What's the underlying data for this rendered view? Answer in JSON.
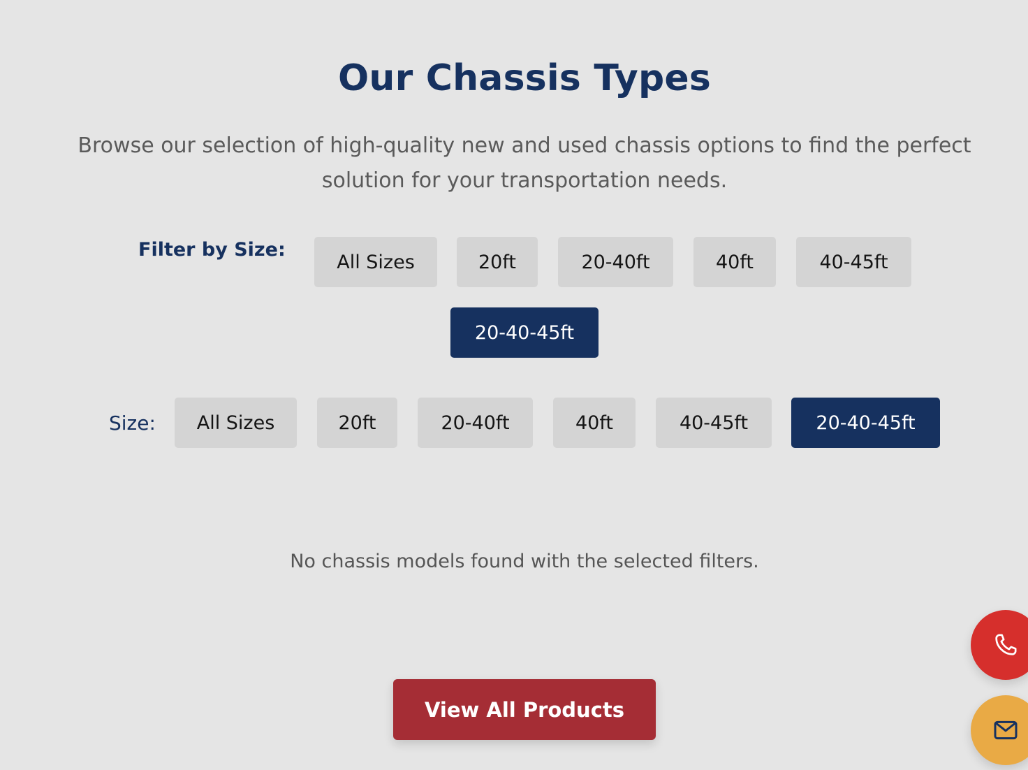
{
  "section": {
    "title": "Our Chassis Types",
    "subtitle": "Browse our selection of high-quality new and used chassis options to find the perfect solution for your transportation needs."
  },
  "filter_by_size": {
    "label": "Filter by Size:",
    "options": [
      "All Sizes",
      "20ft",
      "20-40ft",
      "40ft",
      "40-45ft",
      "20-40-45ft"
    ],
    "selected": "20-40-45ft"
  },
  "size_filter": {
    "label": "Size:",
    "options": [
      "All Sizes",
      "20ft",
      "20-40ft",
      "40ft",
      "40-45ft",
      "20-40-45ft"
    ],
    "selected": "20-40-45ft"
  },
  "results": {
    "empty_message": "No chassis models found with the selected filters."
  },
  "cta": {
    "view_all_label": "View All Products"
  },
  "floating_actions": {
    "phone_icon": "phone-icon",
    "email_icon": "mail-icon"
  },
  "colors": {
    "page_background": "#e5e5e5",
    "brand_navy": "#16315f",
    "chip_background": "#d4d4d4",
    "cta_red": "#a52d35",
    "phone_red": "#d62f2c",
    "email_gold": "#e9aa45"
  }
}
